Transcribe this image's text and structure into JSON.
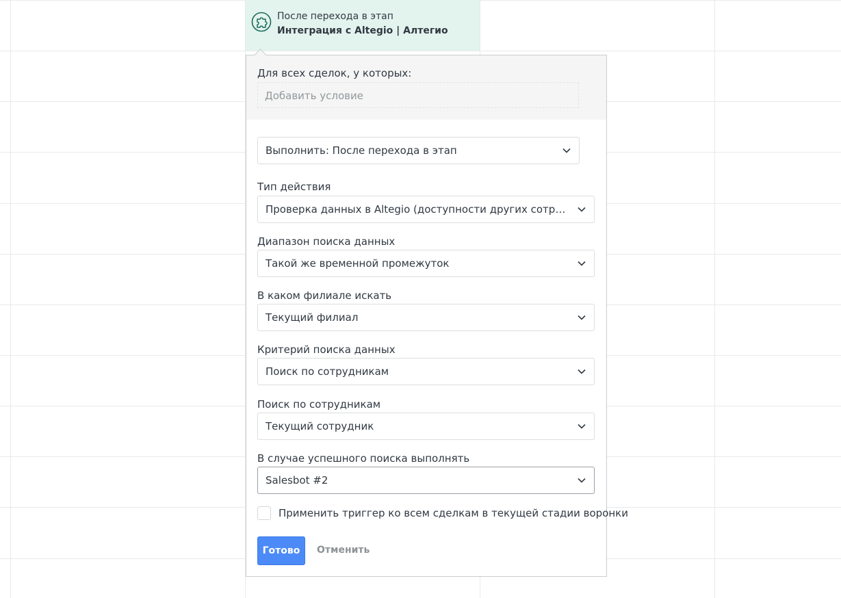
{
  "trigger": {
    "subtitle": "После перехода в этап",
    "title": "Интеграция с Altegio | Алтегио",
    "icon": "puzzle-icon",
    "accent": "#1b6b57"
  },
  "conditions": {
    "label": "Для всех сделок, у которых:",
    "placeholder": "Добавить условие"
  },
  "execute": {
    "value": "Выполнить: После перехода в этап"
  },
  "fields": {
    "action_type": {
      "label": "Тип действия",
      "value": "Проверка данных в Altegio (доступности других сотрудник..."
    },
    "search_range": {
      "label": "Диапазон поиска данных",
      "value": "Такой же временной промежуток"
    },
    "branch": {
      "label": "В каком филиале искать",
      "value": "Текущий филиал"
    },
    "criteria": {
      "label": "Критерий поиска данных",
      "value": "Поиск по сотрудникам"
    },
    "employee_search": {
      "label": "Поиск по сотрудникам",
      "value": "Текущий сотрудник"
    },
    "on_success": {
      "label": "В случае успешного поиска выполнять",
      "value": "Salesbot #2"
    }
  },
  "apply_all": {
    "label": "Применить триггер ко всем сделкам в текущей стадии воронки",
    "checked": false
  },
  "buttons": {
    "done": "Готово",
    "cancel": "Отменить"
  },
  "colors": {
    "primary_button": "#4c8bf7",
    "trigger_bg": "#e3f3ee",
    "condition_bg": "#f5f5f5"
  }
}
